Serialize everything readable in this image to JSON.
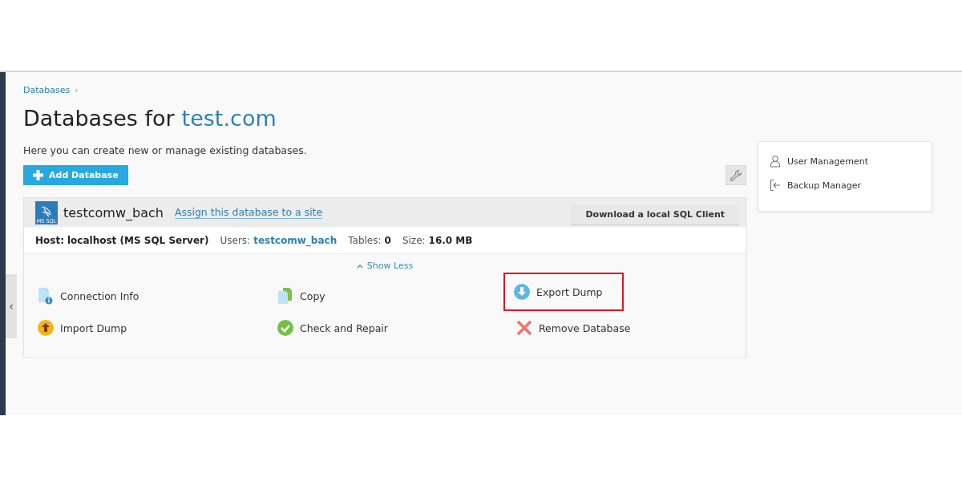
{
  "breadcrumb": [
    {
      "label": "Databases",
      "separator": "›"
    }
  ],
  "title": {
    "prefix": "Databases for",
    "domain": "test.com"
  },
  "description": "Here you can create new or manage existing databases.",
  "toolbar": {
    "add_button": "Add Database"
  },
  "database": {
    "name": "testcomw_bach",
    "logo_text": "MS SQL",
    "assign_link": "Assign this database to a site",
    "download_button": "Download a local SQL Client",
    "info": [
      {
        "kind": "strong",
        "label": "Host:",
        "value": "localhost (MS SQL Server)"
      },
      {
        "kind": "link",
        "label": "Users:",
        "value": "testcomw_bach"
      },
      {
        "kind": "bold",
        "label": "Tables:",
        "value": "0"
      },
      {
        "kind": "bold",
        "label": "Size:",
        "value": "16.0 MB"
      }
    ],
    "toggle": {
      "label": "Show Less",
      "expanded": true
    },
    "actions": [
      {
        "kind": "connection",
        "label": "Connection Info",
        "highlighted": false
      },
      {
        "kind": "copy",
        "label": "Copy",
        "highlighted": false
      },
      {
        "kind": "export",
        "label": "Export Dump",
        "highlighted": true
      },
      {
        "kind": "import",
        "label": "Import Dump",
        "highlighted": false
      },
      {
        "kind": "check",
        "label": "Check and Repair",
        "highlighted": false
      },
      {
        "kind": "remove",
        "label": "Remove Database",
        "highlighted": false
      }
    ]
  },
  "side_panel": {
    "items": [
      {
        "kind": "user",
        "label": "User Management"
      },
      {
        "kind": "backup",
        "label": "Backup Manager"
      }
    ]
  },
  "collapse_handle": {
    "label": "‹"
  }
}
